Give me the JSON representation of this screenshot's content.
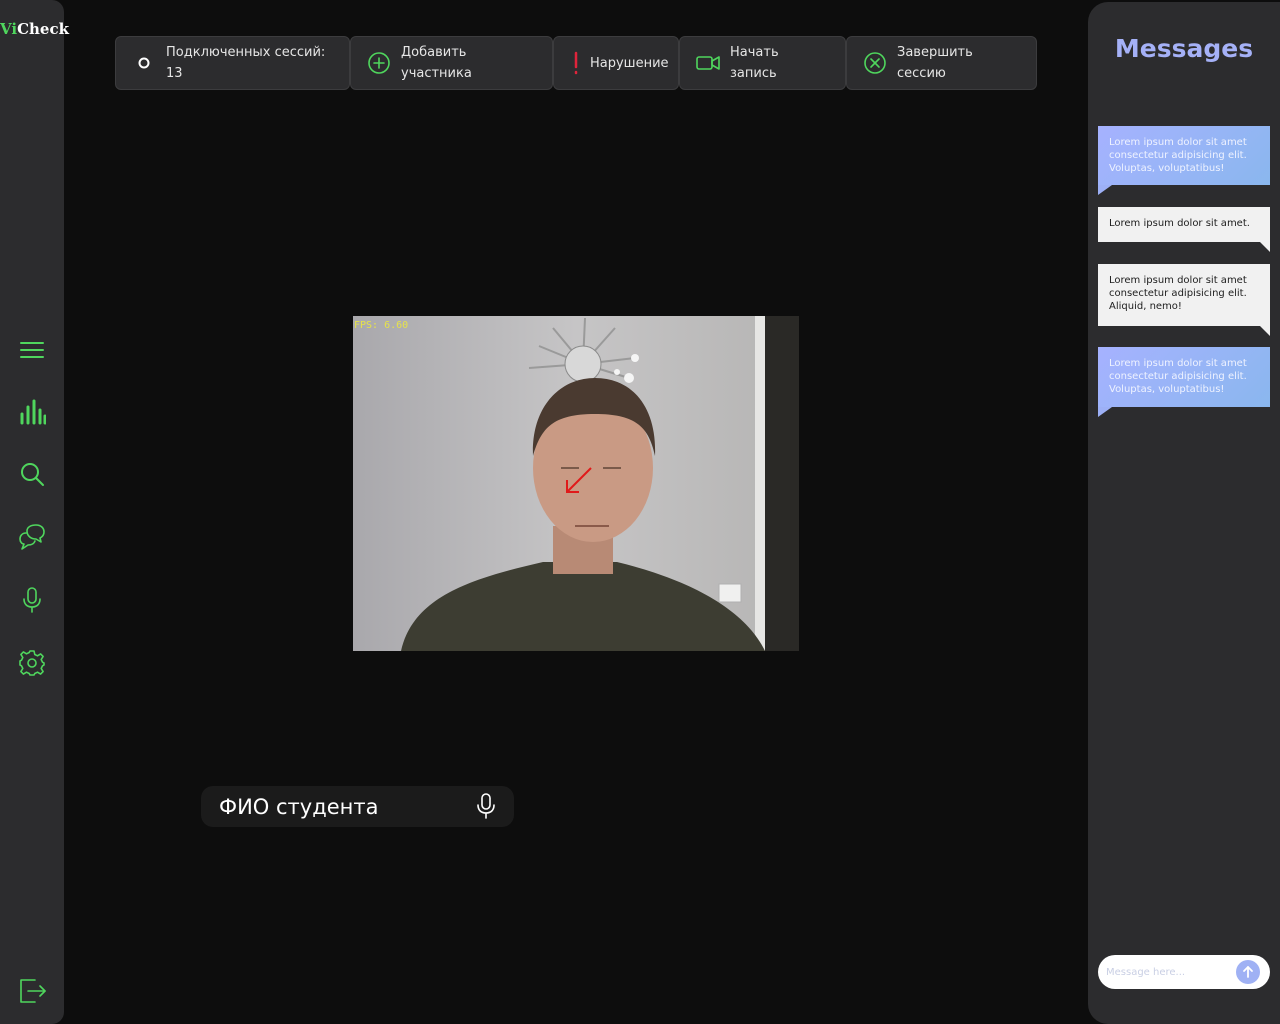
{
  "app": {
    "logo_prefix": "Vi",
    "logo_suffix": "Check"
  },
  "sidebar": {
    "items": [
      {
        "icon": "menu-icon"
      },
      {
        "icon": "bar-chart-icon"
      },
      {
        "icon": "search-icon"
      },
      {
        "icon": "chat-icon"
      },
      {
        "icon": "microphone-icon"
      },
      {
        "icon": "settings-gear-icon"
      }
    ],
    "logout_icon": "logout-icon"
  },
  "toolbar": {
    "sessions_label": "Подключенных сессий:",
    "sessions_count": "13",
    "add_label_1": "Добавить",
    "add_label_2": "участника",
    "violation_label": "Нарушение",
    "record_label_1": "Начать",
    "record_label_2": "запись",
    "end_label_1": "Завершить",
    "end_label_2": "сессию"
  },
  "video": {
    "fps_text": "FPS: 6.60"
  },
  "student": {
    "name_label": "ФИО студента"
  },
  "messages": {
    "title": "Messages",
    "items": [
      {
        "style": "incoming",
        "text": "Lorem ipsum dolor sit amet consectetur adipisicing elit. Voluptas, voluptatibus!"
      },
      {
        "style": "outgoing",
        "text": "Lorem ipsum dolor sit amet."
      },
      {
        "style": "outgoing",
        "text": "Lorem ipsum dolor sit amet consectetur adipisicing elit. Aliquid, nemo!"
      },
      {
        "style": "incoming",
        "text": "Lorem ipsum dolor sit amet consectetur adipisicing elit. Voluptas, voluptatibus!"
      }
    ],
    "input_placeholder": "Message here..."
  },
  "colors": {
    "accent_green": "#4fd65d",
    "accent_blue": "#a5b1f7",
    "violation_red": "#e0243b",
    "panel_bg": "#2c2c2e",
    "page_bg": "#0d0d0d"
  }
}
